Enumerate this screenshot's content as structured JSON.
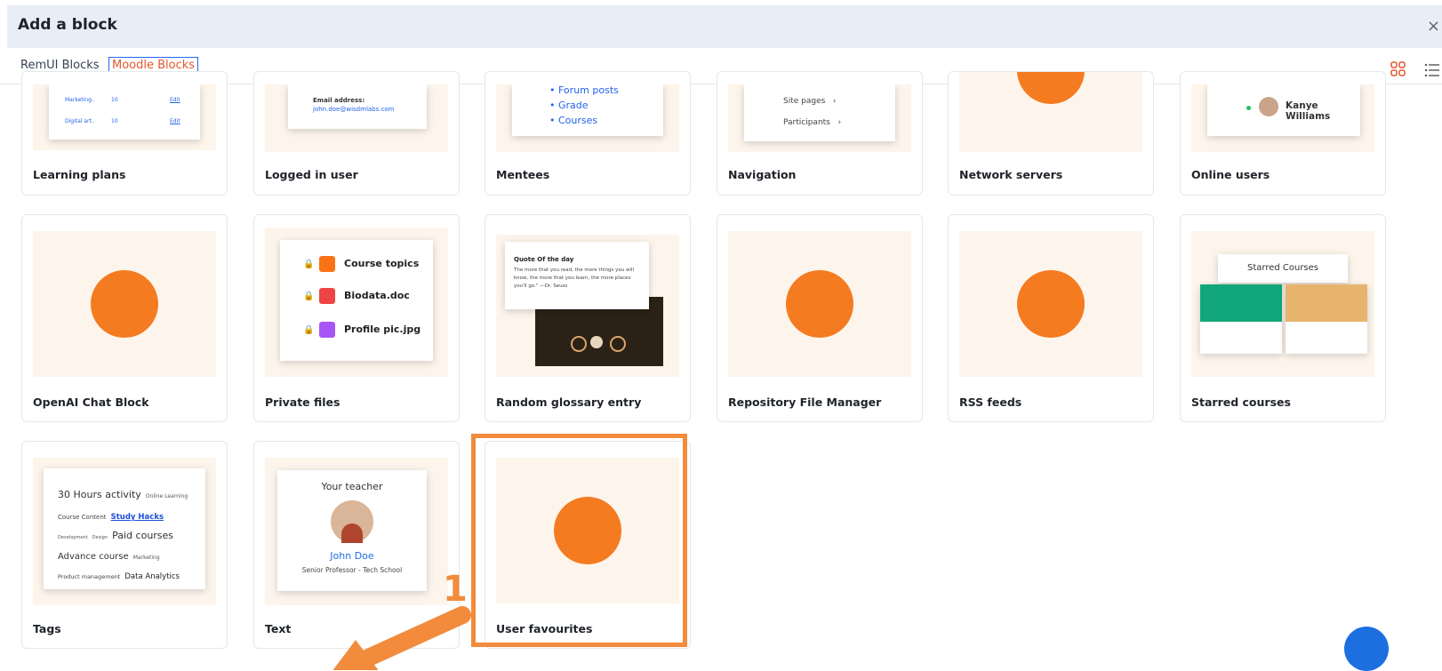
{
  "header": {
    "title": "Add a block",
    "close": "×"
  },
  "tabs": [
    {
      "label": "RemUI Blocks"
    },
    {
      "label": "Moodle Blocks"
    }
  ],
  "colors": {
    "accent": "#e4572e",
    "moodle_orange": "#f47b20",
    "highlight": "#f28b3b",
    "header_bg": "#e8eef7"
  },
  "cards": {
    "learning_plans": {
      "label": "Learning plans",
      "rows": [
        [
          "Marketing..",
          "10",
          "Edit"
        ],
        [
          "Digital art..",
          "10",
          "Edit"
        ]
      ]
    },
    "logged_in_user": {
      "label": "Logged in user",
      "email_label": "Email address:",
      "email": "john.doe@wisdmlabs.com"
    },
    "mentees": {
      "label": "Mentees",
      "items": [
        "Forum posts",
        "Grade",
        "Courses"
      ]
    },
    "navigation": {
      "label": "Navigation",
      "items": [
        "Site pages",
        "Participants"
      ]
    },
    "network_servers": {
      "label": "Network servers"
    },
    "online_users": {
      "label": "Online users",
      "user": "Kanye Williams"
    },
    "openai_chat": {
      "label": "OpenAI Chat Block"
    },
    "private_files": {
      "label": "Private files",
      "files": [
        "Course topics",
        "Biodata.doc",
        "Profile pic.jpg"
      ]
    },
    "random_glossary": {
      "label": "Random glossary entry",
      "quote_title": "Quote Of the day",
      "quote_text": "The more that you read, the more things you will know, the more that you learn, the more places you'll go.\" —Dr. Seuss"
    },
    "repository_file_manager": {
      "label": "Repository File Manager"
    },
    "rss_feeds": {
      "label": "RSS feeds"
    },
    "starred_courses": {
      "label": "Starred courses",
      "panel_title": "Starred Courses"
    },
    "tags": {
      "label": "Tags",
      "tag_lines": [
        [
          "30 Hours activity",
          "Online Learning"
        ],
        [
          "Course Content",
          "Study Hacks"
        ],
        [
          "Development",
          "Design",
          "Paid courses"
        ],
        [
          "Advance course",
          "Marketing"
        ],
        [
          "Product management",
          "Data Analytics"
        ]
      ]
    },
    "text": {
      "label": "Text",
      "heading": "Your teacher",
      "name": "John Doe",
      "role": "Senior Professor - Tech School"
    },
    "user_favourites": {
      "label": "User favourites"
    }
  },
  "annotation": {
    "number": "1"
  }
}
